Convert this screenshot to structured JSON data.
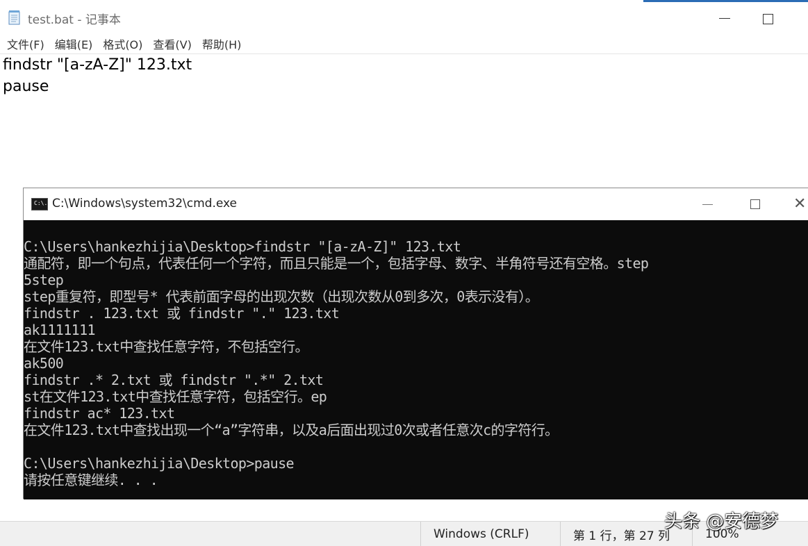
{
  "notepad": {
    "title": "test.bat - 记事本",
    "menu": [
      "文件(F)",
      "编辑(E)",
      "格式(O)",
      "查看(V)",
      "帮助(H)"
    ],
    "lines": [
      "findstr \"[a-zA-Z]\" 123.txt",
      "pause"
    ],
    "status": {
      "encoding": "Windows (CRLF)",
      "position": "第 1 行，第 27 列",
      "zoom": "100%"
    }
  },
  "cmd": {
    "title": "C:\\Windows\\system32\\cmd.exe",
    "icon_label": "C:\\.",
    "lines": [
      "C:\\Users\\hankezhijia\\Desktop>findstr \"[a-zA-Z]\" 123.txt",
      "通配符，即一个句点，代表任何一个字符，而且只能是一个，包括字母、数字、半角符号还有空格。step",
      "5step",
      "step重复符，即型号* 代表前面字母的出现次数（出现次数从0到多次，0表示没有）。",
      "findstr . 123.txt 或 findstr \".\" 123.txt",
      "ak1111111",
      "在文件123.txt中查找任意字符，不包括空行。",
      "ak500",
      "findstr .* 2.txt 或 findstr \".*\" 2.txt",
      "st在文件123.txt中查找任意字符，包括空行。ep",
      "findstr ac* 123.txt",
      "在文件123.txt中查找出现一个“a”字符串，以及a后面出现过0次或者任意次c的字符行。",
      "",
      "C:\\Users\\hankezhijia\\Desktop>pause",
      "请按任意键继续. . ."
    ]
  },
  "watermark": "头条 @安德梦"
}
